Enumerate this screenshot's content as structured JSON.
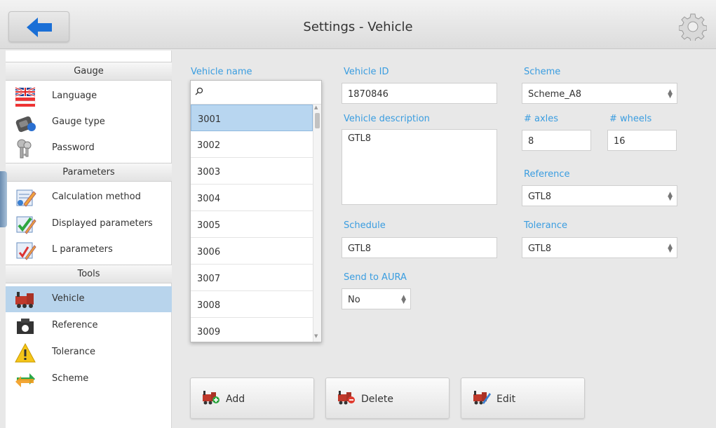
{
  "header": {
    "title": "Settings - Vehicle",
    "back_icon": "back-arrow-icon",
    "settings_icon": "gear-icon"
  },
  "sidebar": {
    "sections": [
      {
        "label": "Gauge"
      },
      {
        "label": "Parameters"
      },
      {
        "label": "Tools"
      }
    ],
    "items": [
      {
        "label": "Language",
        "icon": "flag-icon"
      },
      {
        "label": "Gauge type",
        "icon": "gauge-device-icon"
      },
      {
        "label": "Password",
        "icon": "keys-icon"
      },
      {
        "label": "Calculation method",
        "icon": "calculation-icon"
      },
      {
        "label": "Displayed parameters",
        "icon": "checklist-icon"
      },
      {
        "label": "L parameters",
        "icon": "edit-list-icon"
      },
      {
        "label": "Vehicle",
        "icon": "train-icon"
      },
      {
        "label": "Reference",
        "icon": "reference-icon"
      },
      {
        "label": "Tolerance",
        "icon": "warning-icon"
      },
      {
        "label": "Scheme",
        "icon": "swap-arrows-icon"
      }
    ],
    "active_item": "Vehicle"
  },
  "form": {
    "vehicle_name_label": "Vehicle name",
    "search_placeholder": "",
    "vehicles": [
      "3001",
      "3002",
      "3003",
      "3004",
      "3005",
      "3006",
      "3007",
      "3008",
      "3009"
    ],
    "selected_vehicle": "3001",
    "vehicle_id_label": "Vehicle ID",
    "vehicle_id": "1870846",
    "vehicle_description_label": "Vehicle description",
    "vehicle_description": "GTL8",
    "schedule_label": "Schedule",
    "schedule": "GTL8",
    "send_to_aura_label": "Send to AURA",
    "send_to_aura": "No",
    "scheme_label": "Scheme",
    "scheme": "Scheme_A8",
    "axles_label": "# axles",
    "axles": "8",
    "wheels_label": "# wheels",
    "wheels": "16",
    "reference_label": "Reference",
    "reference": "GTL8",
    "tolerance_label": "Tolerance",
    "tolerance": "GTL8"
  },
  "actions": {
    "add_label": "Add",
    "delete_label": "Delete",
    "edit_label": "Edit"
  },
  "colors": {
    "accent_label": "#3a9de0",
    "selection": "#b8d4ec",
    "back_arrow": "#1a6fd6"
  }
}
